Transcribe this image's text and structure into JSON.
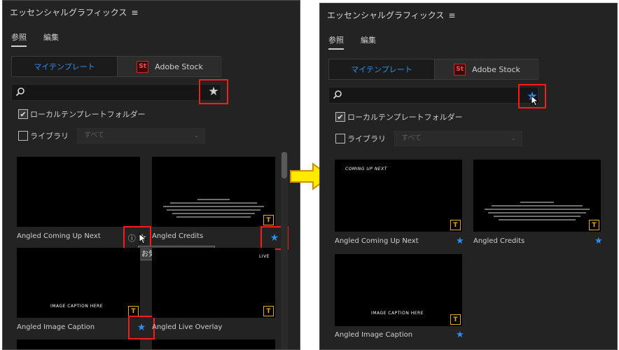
{
  "panel": {
    "title": "エッセンシャルグラフィックス",
    "menu_glyph": "≡",
    "tabs": [
      {
        "label": "参照"
      },
      {
        "label": "編集"
      }
    ],
    "segment": {
      "my_templates": "マイテンプレート",
      "adobe_stock": "Adobe Stock",
      "stock_logo": "St"
    },
    "local_folder_label": "ローカルテンプレートフォルダー",
    "library_label": "ライブラリ",
    "library_select": "すべて"
  },
  "templates": [
    {
      "name": "Angled Coming Up Next",
      "caption": "COMING UP NEXT"
    },
    {
      "name": "Angled Credits"
    },
    {
      "name": "Angled Image Caption",
      "caption": "IMAGE CAPTION HERE"
    },
    {
      "name": "Angled Live Overlay",
      "caption": "LIVE"
    }
  ],
  "tooltip": "お気に入りとして設定",
  "badge_glyph": "T",
  "colors": {
    "accent": "#2f8ef0",
    "highlight": "#ff1a1a",
    "badge": "#e1a623"
  }
}
